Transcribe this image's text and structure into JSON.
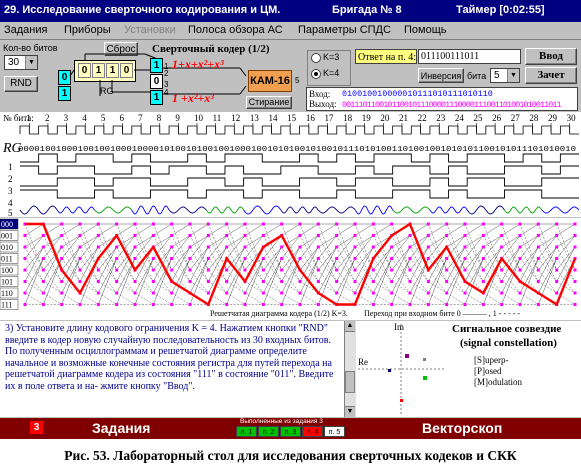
{
  "titlebar": {
    "title": "29. Исследование сверточного кодирования и ЦМ.",
    "team": "Бригада № 8",
    "timer": "Таймер [0:02:55]"
  },
  "menu": [
    {
      "label": "Задания",
      "enabled": true
    },
    {
      "label": "Приборы",
      "enabled": true
    },
    {
      "label": "Установки",
      "enabled": false
    },
    {
      "label": "Полоса обзора АС",
      "enabled": true
    },
    {
      "label": "Параметры СПДС",
      "enabled": true
    },
    {
      "label": "Помощь",
      "enabled": true
    }
  ],
  "controls": {
    "bit_count_label": "Кол-во битов",
    "bit_count_value": "30",
    "rnd_label": "RND",
    "reset_label": "Сброс",
    "encoder_title": "Сверточный кодер (1/2)",
    "register_bits": [
      "0",
      "1",
      "1",
      "0"
    ],
    "input_bits": [
      "0",
      "1"
    ],
    "output_bits": [
      "1",
      "0",
      "1"
    ],
    "poly_top": "1+x+x²+x³",
    "poly_bottom": "1 +x²+x³",
    "rg_label": "RG",
    "kam_label": "КАМ-16",
    "erase_label": "Стирание",
    "pin_labels": [
      "1",
      "2",
      "3",
      "4",
      "5"
    ],
    "k3_label": "K=3",
    "k4_label": "K=4",
    "k_selected": "K=4",
    "answer_label": "Ответ на п. 4:",
    "answer_value": "011100111011",
    "enter_label": "Ввод",
    "inversion_label": "Инверсия",
    "bit_label": "бита",
    "bit_value": "5",
    "credit_label": "Зачет",
    "in_label": "Вход:",
    "in_value": "010010010000010111010111010110",
    "out_label": "Выход:",
    "out_value": "00111011001011001011100001110000111001101001010011011"
  },
  "scope": {
    "bitnum_label": "№ бита:",
    "bit_numbers": [
      "1",
      "2",
      "3",
      "4",
      "5",
      "6",
      "7",
      "8",
      "9",
      "10",
      "11",
      "12",
      "13",
      "14",
      "15",
      "16",
      "17",
      "18",
      "19",
      "20",
      "21",
      "22",
      "23",
      "24",
      "25",
      "26",
      "27",
      "28",
      "29",
      "30"
    ],
    "rg_label": "RG",
    "rg_value": "0000100100010010010001000010100101001001000100101010010100101110101001101001001010101100101011101010010",
    "trace_labels": [
      "1",
      "2",
      "3",
      "4",
      "5"
    ],
    "colors": {
      "blue": "#0000ff",
      "green": "#00a000",
      "darkblue": "#000080"
    }
  },
  "trellis": {
    "state_labels": [
      "000",
      "001",
      "010",
      "011",
      "100",
      "101",
      "110",
      "111"
    ],
    "caption": "Решетчатая диаграмма кодера (1/2) K=3.",
    "legend": "Переход при входном бите 0 ——— , 1 - - - - -",
    "path_color": "#ff0000",
    "box_color": "#ff00ff"
  },
  "task": {
    "text": "3) Установите длину кодового ограничения K = 4. Нажатием кнопки \"RND\" введите в кодер новую случайную последовательность из 30 входных битов. По полученным осциллограммам и решетчатой диаграмме определите начальное и возможные конечные состояния регистра для путей перехода на решетчатой диаграмме кодера из состояния \"111\" в состояние \"011\". Введите их в поле ответа и на- жмите кнопку \"Ввод\"."
  },
  "constellation": {
    "title": "Сигнальное созвездие",
    "subtitle": "(signal constellation)",
    "im_label": "Im",
    "re_label": "Re",
    "ssm": [
      "[S]uperp-",
      "[P]osed",
      "[M]odulation"
    ]
  },
  "status": {
    "tasks_label": "Задания",
    "vectorscope_label": "Векторскоп",
    "done_label": "Выполненные из задания 3",
    "task_num": "3",
    "progress_items": [
      {
        "label": "п. 1",
        "state": "done"
      },
      {
        "label": "п. 2",
        "state": "done"
      },
      {
        "label": "п. 3",
        "state": "done"
      },
      {
        "label": "п. 4",
        "state": "current"
      },
      {
        "label": "п. 5",
        "state": "pending"
      }
    ]
  },
  "caption": "Рис. 53. Лабораторный стол для исследования сверточных кодеков и СКК"
}
